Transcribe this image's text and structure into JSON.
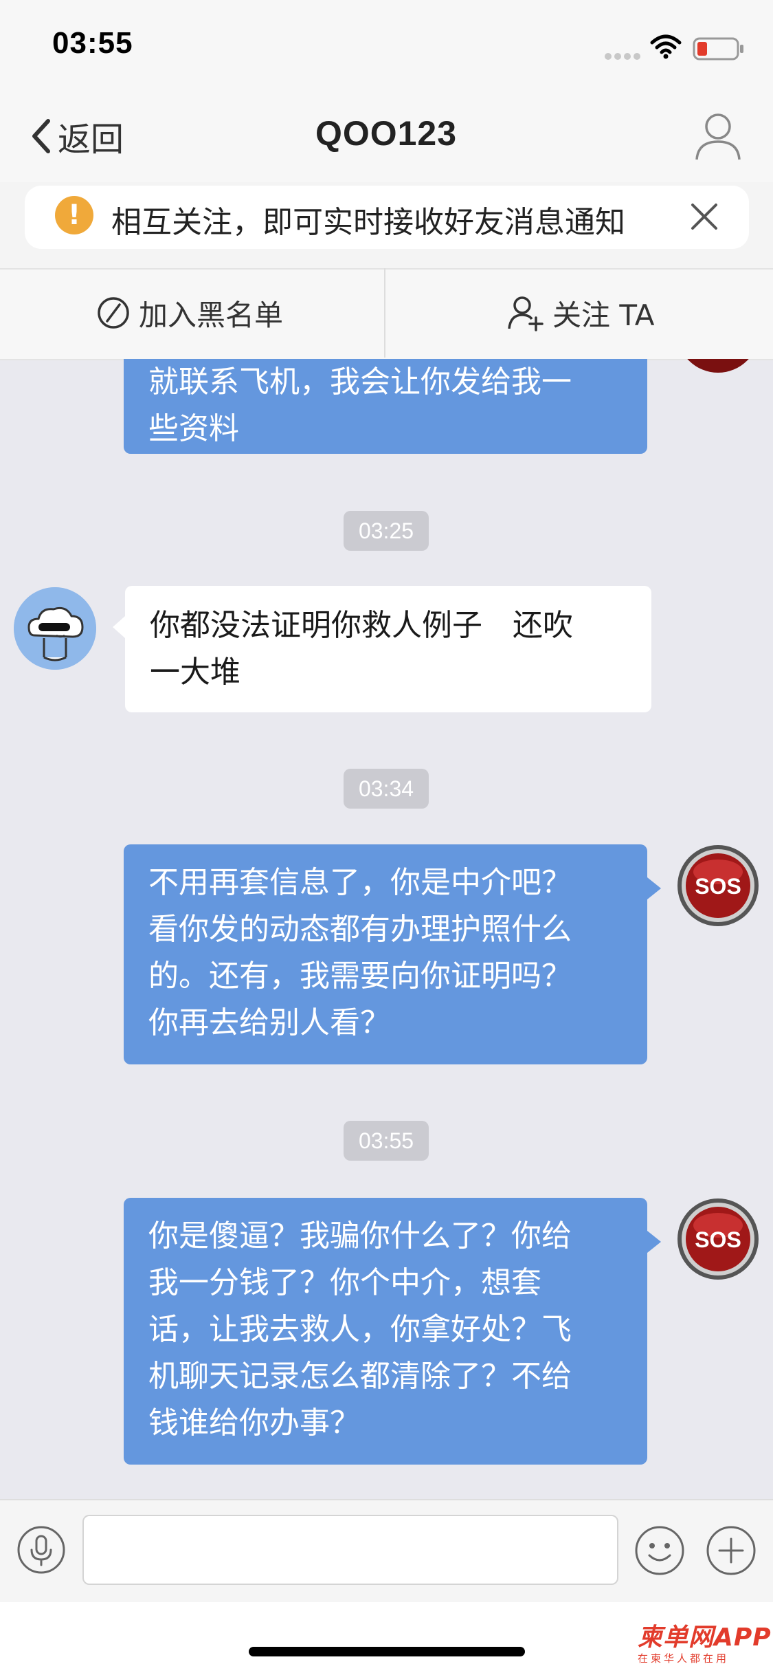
{
  "status_bar": {
    "time": "03:55"
  },
  "nav": {
    "back_label": "返回",
    "title": "QOO123"
  },
  "notice": {
    "icon_glyph": "!",
    "text": "相互关注，即可实时接收好友消息通知"
  },
  "actions": {
    "blacklist_label": "加入黑名单",
    "follow_label": "关注 TA"
  },
  "messages": {
    "m0_text": "就联系飞机，我会让你发给我一\n些资料",
    "t1": "03:25",
    "m1_text": "你都没法证明你救人例子　还吹\n一大堆",
    "t2": "03:34",
    "m2_text": "不用再套信息了，你是中介吧？\n看你发的动态都有办理护照什么\n的。还有，我需要向你证明吗？\n你再去给别人看？",
    "t3": "03:55",
    "m3_text": "你是傻逼？我骗你什么了？你给\n我一分钱了？你个中介，想套\n话，让我去救人，你拿好处？飞\n机聊天记录怎么都清除了？不给\n钱谁给你办事？",
    "sos_label": "SOS"
  },
  "input": {
    "value": ""
  },
  "watermark": {
    "main": "柬单网APP",
    "sub": "在柬华人都在用"
  },
  "colors": {
    "outgoing_bubble": "#6497de",
    "incoming_bubble": "#ffffff",
    "background": "#e9e9ef",
    "timestamp_bg": "#cbcbd1",
    "notice_icon": "#f0a93a",
    "sos_red": "#a01818"
  },
  "icons": {
    "wifi": "wifi-icon",
    "battery": "battery-low-icon",
    "back": "chevron-left-icon",
    "profile": "person-icon",
    "notice": "exclamation-icon",
    "close": "close-icon",
    "blacklist": "prohibit-icon",
    "follow": "person-add-icon",
    "voice": "microphone-icon",
    "emoji": "smiley-icon",
    "plus": "plus-icon"
  }
}
